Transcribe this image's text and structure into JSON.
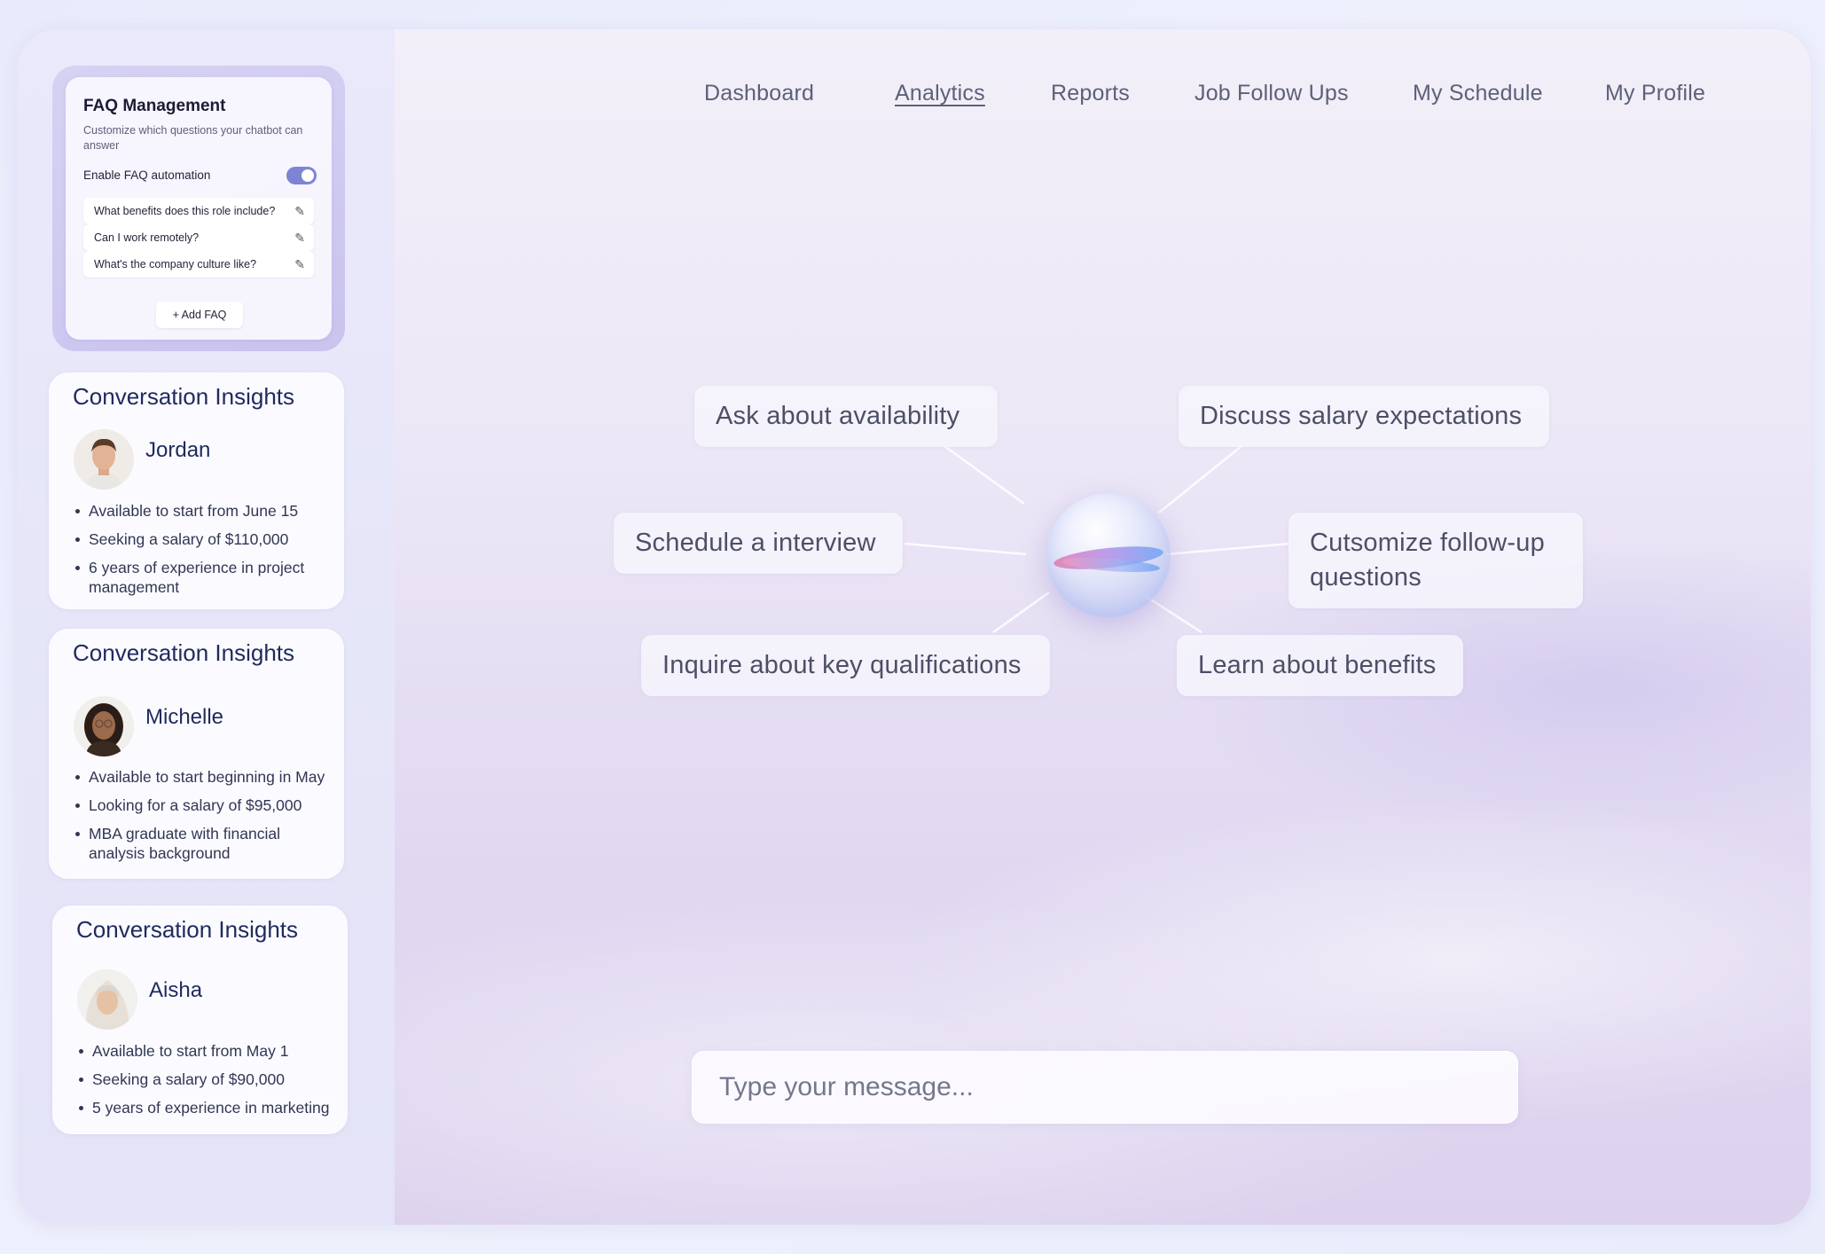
{
  "nav": {
    "items": [
      {
        "label": "Dashboard"
      },
      {
        "label": "Analytics"
      },
      {
        "label": "Reports"
      },
      {
        "label": "Job Follow Ups"
      },
      {
        "label": "My Schedule"
      },
      {
        "label": "My Profile"
      }
    ],
    "active": "Analytics"
  },
  "faq": {
    "title": "FAQ Management",
    "subtitle": "Customize which questions your chatbot can answer",
    "toggle_label": "Enable FAQ automation",
    "toggle_on": true,
    "items": [
      {
        "question": "What benefits does this role include?"
      },
      {
        "question": "Can I work remotely?"
      },
      {
        "question": "What's the company culture like?"
      }
    ],
    "add_label": "+ Add FAQ"
  },
  "insights": [
    {
      "title": "Conversation Insights",
      "name": "Jordan",
      "bullets": [
        "Available to start from June 15",
        "Seeking a salary of $110,000",
        "6 years of experience in project management"
      ]
    },
    {
      "title": "Conversation Insights",
      "name": "Michelle",
      "bullets": [
        "Available to start beginning in May",
        "Looking for a salary of $95,000",
        "MBA graduate with financial analysis background"
      ]
    },
    {
      "title": "Conversation Insights",
      "name": "Aisha",
      "bullets": [
        "Available to start from May 1",
        "Seeking a salary of $90,000",
        "5 years of experience in marketing"
      ]
    }
  ],
  "suggestions": [
    {
      "label": "Ask about availability"
    },
    {
      "label": "Discuss salary expectations"
    },
    {
      "label": "Schedule a interview"
    },
    {
      "label": "Cutsomize follow-up questions"
    },
    {
      "label": "Inquire about key qualifications"
    },
    {
      "label": "Learn about benefits"
    }
  ],
  "message": {
    "placeholder": "Type your message...",
    "value": ""
  },
  "colors": {
    "accent": "#7d84d4",
    "heading": "#1f2a5e",
    "nav_text": "#5d6078"
  }
}
